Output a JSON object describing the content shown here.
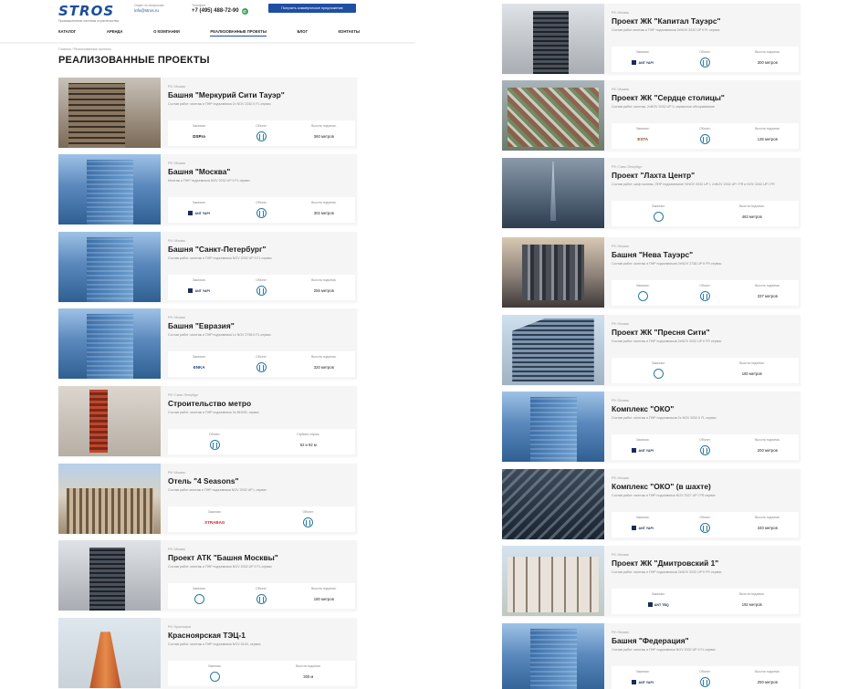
{
  "header": {
    "logo": "STROS",
    "logo_sub": "Промышленные системы строительства",
    "contact_caption": "Отдел по вопросам",
    "email": "info@stros.ru",
    "phone_caption": "Телефон:",
    "phone": "+7 (495) 488-72-90",
    "cta": "Получить коммерческое предложение",
    "nav": [
      "КАТАЛОГ",
      "АРЕНДА",
      "О КОМПАНИИ",
      "РЕАЛИЗОВАННЫЕ ПРОЕКТЫ",
      "БЛОГ",
      "КОНТАКТЫ"
    ]
  },
  "breadcrumb": "Главная  /  Реализованные проекты",
  "page_title": "РЕАЛИЗОВАННЫЕ ПРОЕКТЫ",
  "projects": [
    {
      "loc": "РФ / Москва",
      "name": "Башня \"Меркурий Сити Тауэр\"",
      "desc": "Состав работ: монтаж и ПНР подъемника 2x NOV 2032 II FL сервис",
      "l1": "Заказчик:",
      "c1": "DSPro",
      "l2": "Объект:",
      "l3": "Высота подъема:",
      "v3": "360 метров"
    },
    {
      "loc": "РФ / Москва",
      "name": "Башня \"Москва\"",
      "desc": "Монтаж и ПНР подъемника NOV 2032 UP II FL сервис",
      "l1": "Заказчик:",
      "c1": "ANT YAPI",
      "l2": "Объект:",
      "l3": "Высота подъема:",
      "v3": "302 метров"
    },
    {
      "loc": "РФ / Москва",
      "name": "Башня \"Санкт-Петербург\"",
      "desc": "Состав работ: монтаж и ПНР подъемника NOV 2032 UP II FL сервис",
      "l1": "Заказчик:",
      "c1": "ANT YAPI",
      "l2": "Объект:",
      "l3": "Высота подъема:",
      "v3": "255 метров"
    },
    {
      "loc": "РФ / Москва",
      "name": "Башня \"Евразия\"",
      "desc": "Состав работ: монтаж и ПНР подъемника 1x NOV 2738 II FL сервис",
      "l1": "Заказчик:",
      "c1": "ENKA",
      "l2": "Объект:",
      "l3": "Высота подъема:",
      "v3": "320 метров"
    },
    {
      "loc": "РФ / Санкт-Петербург",
      "name": "Строительство метро",
      "desc": "Состав работ: монтаж и ПНР подъемника 3x BH430, сервис",
      "l1": "",
      "c1": "",
      "l2": "Объект:",
      "l3": "Глубина спуска:",
      "v3": "62 и 92 м"
    },
    {
      "loc": "РФ / Москва",
      "name": "Отель \"4 Seasons\"",
      "desc": "Состав работ монтаж и ПНР подъемника NOV 2032 UP I, сервис",
      "l1": "Заказчик:",
      "c1": "STRABAG",
      "l2": "Объект:",
      "l3": "",
      "v3": ""
    },
    {
      "loc": "РФ / Москва",
      "name": "Проект АТК \"Башня Москвы\"",
      "desc": "Состав работ: монтаж и ПНР подъемника NOV 2032 UP II FL сервис",
      "l1": "Заказчик:",
      "c1": "",
      "l2": "Объект:",
      "l3": "Высота подъема:",
      "v3": "180 метров"
    },
    {
      "loc": "РФ / Красноярск",
      "name": "Красноярская ТЭЦ-1",
      "desc": "Состав работ: монтаж и ПНР подъемника NOV 514X, сервис",
      "l1": "Заказчик:",
      "c1": "",
      "l2": "",
      "l3": "Высота подъема:",
      "v3": "300 м"
    },
    {
      "loc": "РФ / Москва",
      "name": "Проект ЖК \"Капитал Тауэрс\"",
      "desc": "Состав работ монтаж и ПНР подъемников 2xNOV 3242 UP II FL сервис",
      "l1": "Заказчик:",
      "c1": "ANT YAPI",
      "l2": "Объект:",
      "l3": "Высота подъема:",
      "v3": "300 метров"
    },
    {
      "loc": "РФ / Москва",
      "name": "Проект ЖК \"Сердце столицы\"",
      "desc": "Состав работ: монтаж, 2xNOV 2032 UP II, сервисное обслуживание",
      "l1": "Заказчик:",
      "c1": "ESTA",
      "l2": "Объект:",
      "l3": "Высота подъема:",
      "v3": "135 метров"
    },
    {
      "loc": "РФ / Санкт-Петербург",
      "name": "Проект \"Лахта Центр\"",
      "desc": "Состав работ: шеф монтаж, ПНР подъемников 7xNOV 2032 UP I, 2xNOV 2032 UP I FR и NOV 3242 UP I FR",
      "l1": "Заказчик:",
      "c1": "",
      "l2": "",
      "l3": "Высота подъема:",
      "v3": "463 метров"
    },
    {
      "loc": "РФ / Москва",
      "name": "Башня \"Нева Тауэрс\"",
      "desc": "Состав работ: монтаж и ПНР подъемников 2xNOV 2738 UP II FR сервис",
      "l1": "Заказчик:",
      "c1": "",
      "l2": "Объект:",
      "l3": "Высота подъема:",
      "v3": "337 метров"
    },
    {
      "loc": "РФ / Москва",
      "name": "Проект ЖК \"Пресня Сити\"",
      "desc": "Состав работ: монтаж и ПНР подъемников 2xNOV 2032 UP II FR сервис",
      "l1": "Заказчик:",
      "c1": "",
      "l2": "",
      "l3": "Высота подъема:",
      "v3": "160 метров"
    },
    {
      "loc": "РФ / Москва",
      "name": "Комплекс \"ОКО\"",
      "desc": "Состав работ: монтаж и ПНР подъемников 2x NOV 2032 II FL сервис",
      "l1": "Заказчик:",
      "c1": "ANT YAPI",
      "l2": "Объект:",
      "l3": "Высота подъема:",
      "v3": "200 метров"
    },
    {
      "loc": "РФ / Москва",
      "name": "Комплекс \"ОКО\" (в шахте)",
      "desc": "Состав работ: монтаж и ПНР подъемника NOV 2027 UP I FR сервис",
      "l1": "Заказчик:",
      "c1": "ANT YAPI",
      "l2": "Объект:",
      "l3": "Высота подъема:",
      "v3": "340 метров"
    },
    {
      "loc": "РФ / Москва",
      "name": "Проект ЖК \"Дмитровский 1\"",
      "desc": "Состав работ: монтаж и ПНР подъемников 2xNOV 2032 UP II FR сервис",
      "l1": "Заказчик:",
      "c1": "ANT TBQ",
      "l2": "",
      "l3": "Высота подъема:",
      "v3": "192 метров"
    },
    {
      "loc": "РФ / Москва",
      "name": "Башня \"Федерация\"",
      "desc": "Состав работ: монтаж и ПНР подъемника NOV 2032 UP II FL сервис",
      "l1": "Заказчик:",
      "c1": "ANT YAPI",
      "l2": "Объект:",
      "l3": "Высота подъема:",
      "v3": "250 метров"
    }
  ]
}
